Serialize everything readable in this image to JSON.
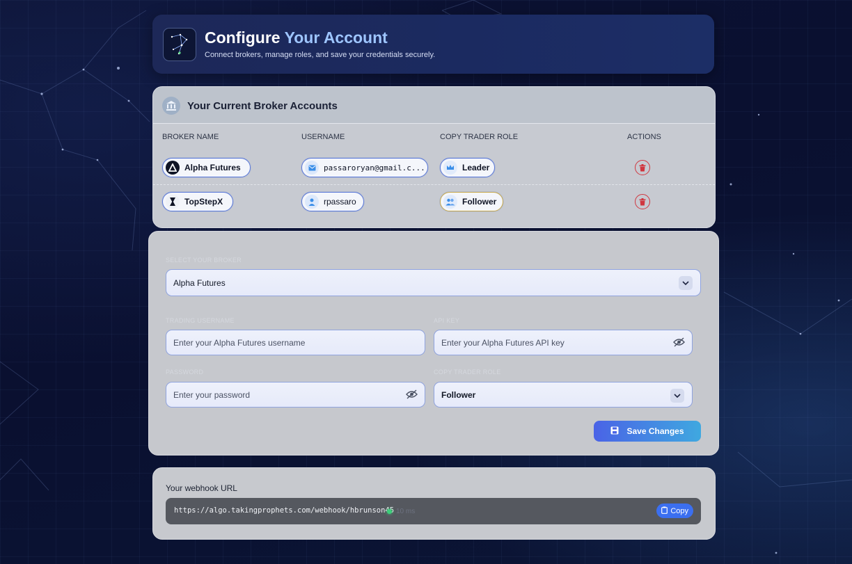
{
  "header": {
    "title_main": "Configure",
    "title_accent": "Your Account",
    "subtitle": "Connect brokers, manage roles, and save your credentials securely."
  },
  "accounts": {
    "title": "Your Current Broker Accounts",
    "columns": [
      "BROKER NAME",
      "USERNAME",
      "COPY TRADER ROLE",
      "ACTIONS"
    ],
    "rows": [
      {
        "broker": "Alpha Futures",
        "broker_icon": "alpha-futures-logo-icon",
        "username": "passaroryan@gmail.c...",
        "username_icon": "mail-icon",
        "role": "Leader",
        "role_icon": "crown-icon"
      },
      {
        "broker": "TopStepX",
        "broker_icon": "topstepx-logo-icon",
        "username": "rpassaro",
        "username_icon": "user-icon",
        "role": "Follower",
        "role_icon": "users-icon"
      }
    ]
  },
  "form": {
    "broker_label": "SELECT YOUR BROKER",
    "broker_value": "Alpha Futures",
    "username_label": "TRADING USERNAME",
    "username_placeholder": "Enter your Alpha Futures username",
    "api_label": "API KEY",
    "api_placeholder": "Enter your Alpha Futures API key",
    "password_label": "PASSWORD",
    "password_placeholder": "Enter your password",
    "role_label": "COPY TRADER ROLE",
    "role_value": "Follower",
    "save_label": "Save Changes"
  },
  "webhook": {
    "label": "Your webhook URL",
    "url": "https://algo.takingprophets.com/webhook/hbrunson45",
    "status": "10 ms",
    "copy_label": "Copy"
  },
  "colors": {
    "accent": "#9ec5ff",
    "danger": "#d0363f",
    "button_start": "#4a63e6",
    "button_end": "#3fa8e0",
    "status_ok": "#3ccf7a"
  }
}
